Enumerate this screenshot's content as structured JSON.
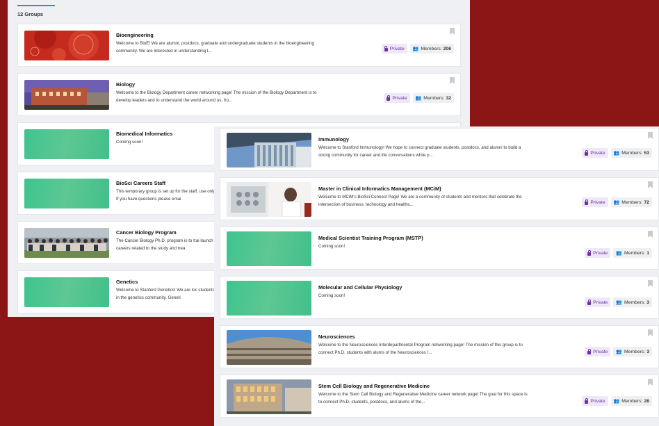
{
  "left_panel": {
    "group_count": "12 Groups",
    "cards": [
      {
        "title": "Bioengineering",
        "desc": "Welcome to BioE!  We are alumni, postdocs, graduate and undergraduate students in the bioengineering community.  We are interested in understanding t...",
        "private": "Private",
        "members_label": "Members:",
        "members": "206"
      },
      {
        "title": "Biology",
        "desc": "Welcome to the Biology Department career networking page! The mission of the Biology Department is to develop leaders and to understand the world around us, fro...",
        "private": "Private",
        "members_label": "Members:",
        "members": "32"
      },
      {
        "title": "Biomedical Informatics",
        "desc": "Coming soon!"
      },
      {
        "title": "BioSci Careers Staff",
        "desc": "This temporary group is set up for the staff, use only.  If you have questions please emai"
      },
      {
        "title": "Cancer Biology Program",
        "desc": "The Cancer Biology Ph.D. program is to trai launch careers related to the study and trea"
      },
      {
        "title": "Genetics",
        "desc": "Welcome to Stanford Genetics! We are loc students in the genetics community. Geneti"
      }
    ]
  },
  "right_panel": {
    "cards": [
      {
        "title": "Immunology",
        "desc": "Welcome to Stanford Immunology! We hope to connect graduate students, postdocs, and alumni to build a strong community for career and life conversations while p...",
        "private": "Private",
        "members_label": "Members:",
        "members": "53"
      },
      {
        "title": "Master in Clinical Informatics Management (MCiM)",
        "desc": "Welcome to MCiM's BioSci Connect Page! We are a community of students and mentors that celebrate the intersection of business, technology and healthc...",
        "private": "Private",
        "members_label": "Members:",
        "members": "72"
      },
      {
        "title": "Medical Scientist Training Program (MSTP)",
        "desc": "Coming soon!",
        "private": "Private",
        "members_label": "Members:",
        "members": "1"
      },
      {
        "title": "Molecular and Cellular Physiology",
        "desc": "Coming soon!",
        "private": "Private",
        "members_label": "Members:",
        "members": "3"
      },
      {
        "title": "Neurosciences",
        "desc": "Welcome to the Neurosciences Interdepartmental Program networking page! The mission of this group is to connect Ph.D. students with alums of the Neurosciences I...",
        "private": "Private",
        "members_label": "Members:",
        "members": "3"
      },
      {
        "title": "Stem Cell Biology and Regenerative Medicine",
        "desc": "Welcome to the Stem Cell Biology and Regenerative Medicine career network page! The goal for this space is to connect Ph.D. students, postdocs, and alums of the...",
        "private": "Private",
        "members_label": "Members:",
        "members": "28"
      }
    ]
  },
  "icons": {
    "bookmark": "bookmark-icon",
    "lock": "lock-icon",
    "members": "people-icon"
  },
  "colors": {
    "background": "#8c1515",
    "private_text": "#6b2fa6",
    "private_bg": "#efe9f7",
    "thumb_green": "#3ec48f"
  }
}
